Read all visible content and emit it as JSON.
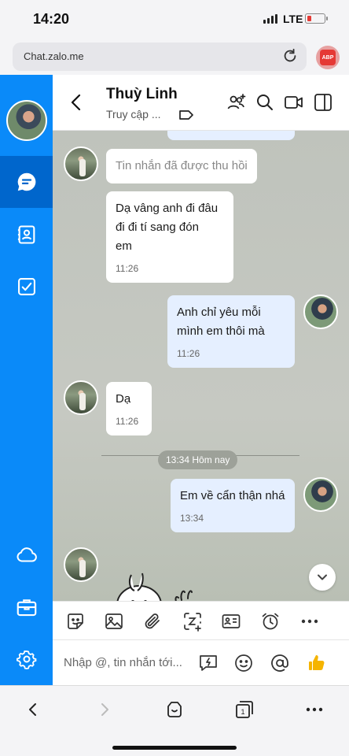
{
  "status_bar": {
    "time": "14:20",
    "network": "LTE"
  },
  "browser": {
    "url": "Chat.zalo.me",
    "adblock_label": "ABP"
  },
  "header": {
    "contact_name": "Thuỳ Linh",
    "status": "Truy cập ..."
  },
  "messages": [
    {
      "from": "contact",
      "text": "Tin nhắn đã được thu hồi",
      "recalled": true
    },
    {
      "from": "contact",
      "lines": [
        "Dạ vâng anh đi đâu",
        "đi đi tí sang đón",
        "em"
      ],
      "time": "11:26"
    },
    {
      "from": "me",
      "lines": [
        "Anh chỉ yêu mỗi",
        "mình em thôi mà"
      ],
      "time": "11:26"
    },
    {
      "from": "contact",
      "text": "Dạ",
      "time": "11:26"
    },
    {
      "from": "me",
      "text": "Em về cẩn thận nhá",
      "time": "13:34"
    }
  ],
  "divider_label": "13:34 Hôm nay",
  "composer": {
    "placeholder": "Nhập @, tin nhắn tới..."
  },
  "colors": {
    "sidebar": "#0a8af9",
    "sidebar_active": "#0066cc",
    "my_bubble": "#e5efff",
    "accent": "#0068ff",
    "like": "#f5b400"
  },
  "icons": {
    "sidebar": [
      "chat-icon",
      "contacts-icon",
      "todo-icon",
      "cloud-icon",
      "toolbox-icon",
      "settings-icon"
    ],
    "header": [
      "back-icon",
      "tag-icon",
      "add-member-icon",
      "search-icon",
      "video-call-icon",
      "sidebar-toggle-icon"
    ],
    "toolbar": [
      "sticker-icon",
      "image-icon",
      "attachment-icon",
      "screenshot-icon",
      "business-card-icon",
      "reminder-icon",
      "more-icon"
    ],
    "composer": [
      "quick-message-icon",
      "emoji-icon",
      "mention-icon",
      "like-icon"
    ],
    "safari": [
      "back-icon",
      "forward-icon",
      "share-icon",
      "tabs-icon",
      "more-icon"
    ]
  },
  "safari": {
    "tab_count": "1"
  }
}
